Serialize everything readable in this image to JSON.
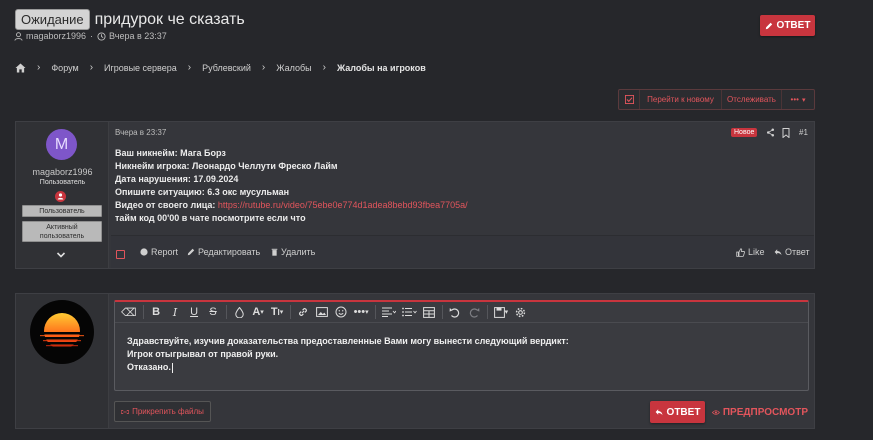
{
  "thread": {
    "prefix": "Ожидание",
    "title": "придурок че сказать",
    "author": "magaborz1996",
    "date": "Вчера в 23:37",
    "reply_label": "ОТВЕТ"
  },
  "breadcrumb": [
    "Форум",
    "Игровые сервера",
    "Рублевский",
    "Жалобы",
    "Жалобы на игроков"
  ],
  "thread_actions": {
    "jump_new": "Перейти к новому",
    "watch": "Отслеживать",
    "more": "•••"
  },
  "post": {
    "avatar_letter": "M",
    "username": "magaborz1996",
    "user_title": "Пользователь",
    "banner_1": "Пользователь",
    "banner_2_line1": "Активный",
    "banner_2_line2": "пользователь",
    "date": "Вчера в 23:37",
    "new_badge": "Новое",
    "number": "#1",
    "lines": [
      "Ваш никнейм: Мага Борз",
      "Никнейм игрока: Леонардо Челлути Фреско Лайм",
      "Дата нарушения: 17.09.2024",
      "Опишите ситуацию: 6.3 окс мусульман"
    ],
    "video_label": "Видео от своего лица: ",
    "video_link": "https://rutube.ru/video/75ebe0e774d1adea8bebd93fbea7705a/",
    "last_line": "тайм код 00'00 в чате посмотрите если что",
    "actions": {
      "report": "Report",
      "edit": "Редактировать",
      "delete": "Удалить",
      "like": "Like",
      "reply": "Ответ"
    }
  },
  "editor": {
    "lines": [
      "Здравствуйте, изучив доказательства предоставленные Вами могу вынести следующий вердикт:",
      "Игрок отыгрывал от правой руки.",
      "Отказано."
    ],
    "attach_label": "Прикрепить файлы",
    "submit_label": "ОТВЕТ",
    "preview_label": "ПРЕДПРОСМОТР"
  },
  "colors": {
    "accent": "#c8353e",
    "link": "#e2555c",
    "background": "#26272b",
    "panel": "#35363b"
  }
}
